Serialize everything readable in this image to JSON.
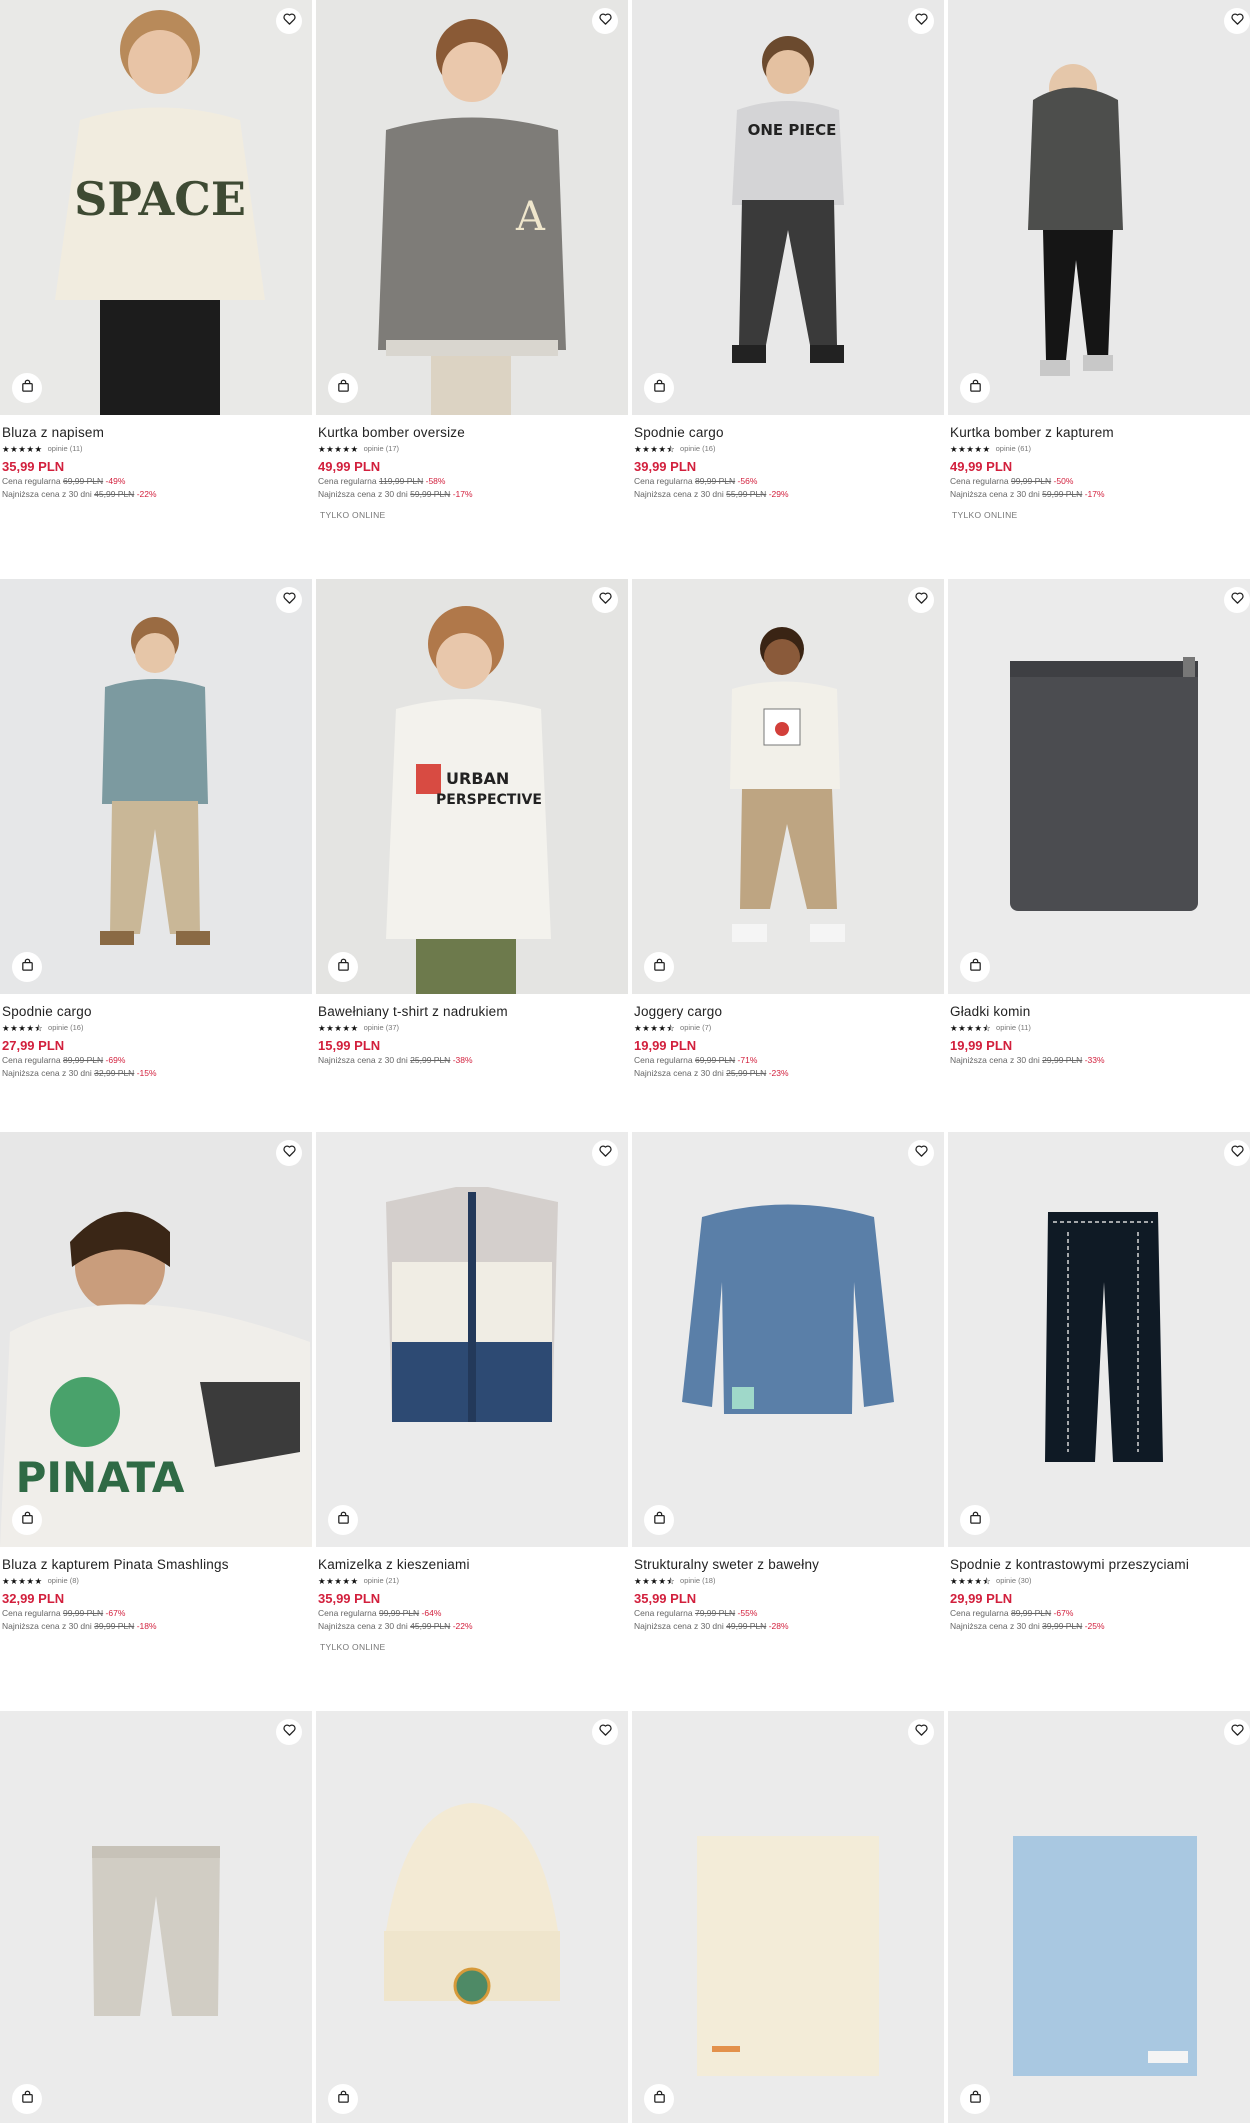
{
  "icons": {
    "wishlist": "heart-outline-icon",
    "add_to_bag": "shopping-bag-icon",
    "rating": "star-icon"
  },
  "colors": {
    "price": "#d21f3c",
    "discount": "#d21f3c",
    "image_bg": "#eceef0"
  },
  "labels": {
    "regular_price": "Cena regularna",
    "lowest_30d": "Najniższa cena z 30 dni",
    "reviews_word": "opinie"
  },
  "products": [
    {
      "name": "Bluza z napisem",
      "stars": "★★★★★",
      "reviews": "opinie (11)",
      "price": "35,99 PLN",
      "regular_label": "Cena regularna",
      "regular_old": "69,99 PLN",
      "regular_disc": "-49%",
      "lowest_label": "Najniższa cena z 30 dni",
      "lowest_old": "45,99 PLN",
      "lowest_disc": "-22%",
      "badge": ""
    },
    {
      "name": "Kurtka bomber oversize",
      "stars": "★★★★★",
      "reviews": "opinie (17)",
      "price": "49,99 PLN",
      "regular_label": "Cena regularna",
      "regular_old": "119,99 PLN",
      "regular_disc": "-58%",
      "lowest_label": "Najniższa cena z 30 dni",
      "lowest_old": "59,99 PLN",
      "lowest_disc": "-17%",
      "badge": "TYLKO ONLINE"
    },
    {
      "name": "Spodnie cargo",
      "stars": "★★★★⯪",
      "reviews": "opinie (16)",
      "price": "39,99 PLN",
      "regular_label": "Cena regularna",
      "regular_old": "89,99 PLN",
      "regular_disc": "-56%",
      "lowest_label": "Najniższa cena z 30 dni",
      "lowest_old": "55,99 PLN",
      "lowest_disc": "-29%",
      "badge": ""
    },
    {
      "name": "Kurtka bomber z kapturem",
      "stars": "★★★★★",
      "reviews": "opinie (61)",
      "price": "49,99 PLN",
      "regular_label": "Cena regularna",
      "regular_old": "99,99 PLN",
      "regular_disc": "-50%",
      "lowest_label": "Najniższa cena z 30 dni",
      "lowest_old": "59,99 PLN",
      "lowest_disc": "-17%",
      "badge": "TYLKO ONLINE"
    },
    {
      "name": "Spodnie cargo",
      "stars": "★★★★⯪",
      "reviews": "opinie (16)",
      "price": "27,99 PLN",
      "regular_label": "Cena regularna",
      "regular_old": "89,99 PLN",
      "regular_disc": "-69%",
      "lowest_label": "Najniższa cena z 30 dni",
      "lowest_old": "32,99 PLN",
      "lowest_disc": "-15%",
      "badge": ""
    },
    {
      "name": "Bawełniany t-shirt z nadrukiem",
      "stars": "★★★★★",
      "reviews": "opinie (37)",
      "price": "15,99 PLN",
      "regular_label": "",
      "regular_old": "",
      "regular_disc": "",
      "lowest_label": "Najniższa cena z 30 dni",
      "lowest_old": "25,99 PLN",
      "lowest_disc": "-38%",
      "badge": ""
    },
    {
      "name": "Joggery cargo",
      "stars": "★★★★⯪",
      "reviews": "opinie (7)",
      "price": "19,99 PLN",
      "regular_label": "Cena regularna",
      "regular_old": "69,99 PLN",
      "regular_disc": "-71%",
      "lowest_label": "Najniższa cena z 30 dni",
      "lowest_old": "25,99 PLN",
      "lowest_disc": "-23%",
      "badge": ""
    },
    {
      "name": "Gładki komin",
      "stars": "★★★★⯪",
      "reviews": "opinie (11)",
      "price": "19,99 PLN",
      "regular_label": "",
      "regular_old": "",
      "regular_disc": "",
      "lowest_label": "Najniższa cena z 30 dni",
      "lowest_old": "29,99 PLN",
      "lowest_disc": "-33%",
      "badge": ""
    },
    {
      "name": "Bluza z kapturem Pinata Smashlings",
      "stars": "★★★★★",
      "reviews": "opinie (8)",
      "price": "32,99 PLN",
      "regular_label": "Cena regularna",
      "regular_old": "99,99 PLN",
      "regular_disc": "-67%",
      "lowest_label": "Najniższa cena z 30 dni",
      "lowest_old": "39,99 PLN",
      "lowest_disc": "-18%",
      "badge": ""
    },
    {
      "name": "Kamizelka z kieszeniami",
      "stars": "★★★★★",
      "reviews": "opinie (21)",
      "price": "35,99 PLN",
      "regular_label": "Cena regularna",
      "regular_old": "99,99 PLN",
      "regular_disc": "-64%",
      "lowest_label": "Najniższa cena z 30 dni",
      "lowest_old": "45,99 PLN",
      "lowest_disc": "-22%",
      "badge": "TYLKO ONLINE"
    },
    {
      "name": "Strukturalny sweter z bawełny",
      "stars": "★★★★⯪",
      "reviews": "opinie (18)",
      "price": "35,99 PLN",
      "regular_label": "Cena regularna",
      "regular_old": "79,99 PLN",
      "regular_disc": "-55%",
      "lowest_label": "Najniższa cena z 30 dni",
      "lowest_old": "49,99 PLN",
      "lowest_disc": "-28%",
      "badge": ""
    },
    {
      "name": "Spodnie z kontrastowymi przeszyciami",
      "stars": "★★★★⯪",
      "reviews": "opinie (30)",
      "price": "29,99 PLN",
      "regular_label": "Cena regularna",
      "regular_old": "89,99 PLN",
      "regular_disc": "-67%",
      "lowest_label": "Najniższa cena z 30 dni",
      "lowest_old": "39,99 PLN",
      "lowest_disc": "-25%",
      "badge": ""
    },
    {
      "name": "",
      "stars": "",
      "reviews": "",
      "price": "",
      "regular_label": "",
      "regular_old": "",
      "regular_disc": "",
      "lowest_label": "",
      "lowest_old": "",
      "lowest_disc": "",
      "badge": ""
    },
    {
      "name": "",
      "stars": "",
      "reviews": "",
      "price": "",
      "regular_label": "",
      "regular_old": "",
      "regular_disc": "",
      "lowest_label": "",
      "lowest_old": "",
      "lowest_disc": "",
      "badge": ""
    },
    {
      "name": "",
      "stars": "",
      "reviews": "",
      "price": "",
      "regular_label": "",
      "regular_old": "",
      "regular_disc": "",
      "lowest_label": "",
      "lowest_old": "",
      "lowest_disc": "",
      "badge": ""
    },
    {
      "name": "",
      "stars": "",
      "reviews": "",
      "price": "",
      "regular_label": "",
      "regular_old": "",
      "regular_disc": "",
      "lowest_label": "",
      "lowest_old": "",
      "lowest_disc": "",
      "badge": ""
    }
  ]
}
